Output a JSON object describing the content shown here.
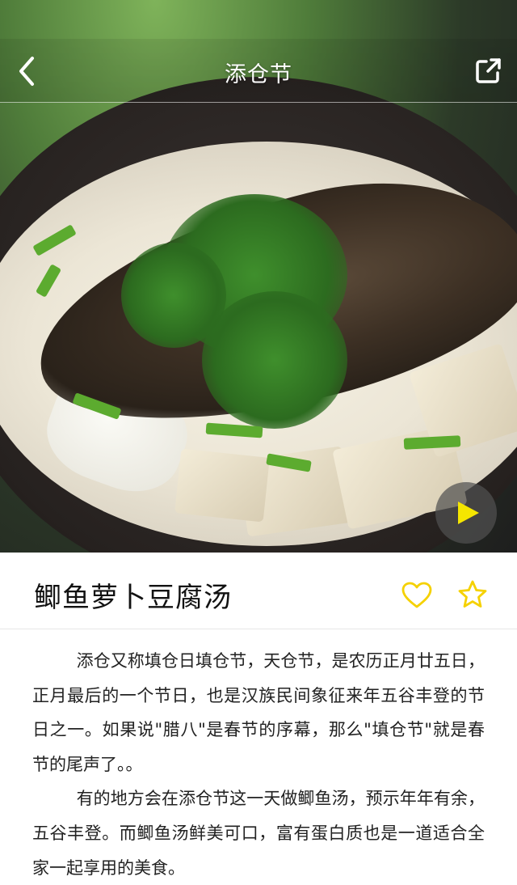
{
  "header": {
    "title": "添仓节",
    "back_icon": "chevron-left-icon",
    "share_icon": "share-icon"
  },
  "media": {
    "image_alt": "鲫鱼萝卜豆腐汤",
    "play_icon": "play-icon",
    "play_color": "#f5e600"
  },
  "recipe": {
    "title": "鲫鱼萝卜豆腐汤",
    "like_icon": "heart-outline-icon",
    "favorite_icon": "star-outline-icon",
    "accent_color": "#f5d100"
  },
  "article": {
    "paragraphs": [
      "添仓又称填仓日填仓节，天仓节，是农历正月廿五日，正月最后的一个节日，也是汉族民间象征来年五谷丰登的节日之一。如果说\"腊八\"是春节的序幕，那么\"填仓节\"就是春节的尾声了。。",
      "有的地方会在添仓节这一天做鲫鱼汤，预示年年有余，五谷丰登。而鲫鱼汤鲜美可口，富有蛋白质也是一道适合全家一起享用的美食。"
    ]
  }
}
